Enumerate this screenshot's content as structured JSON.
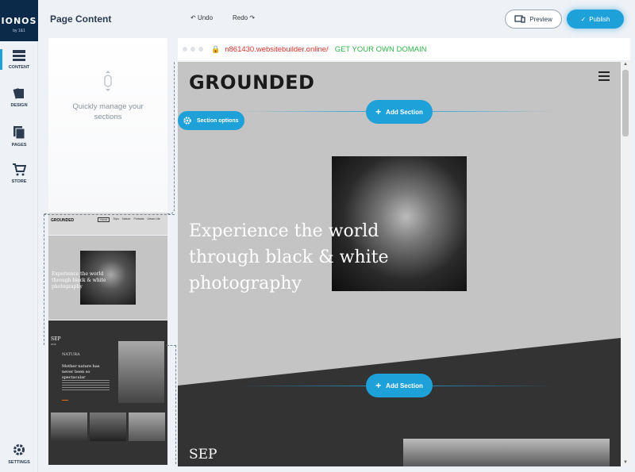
{
  "rail": {
    "brand": "IONOS",
    "brand_sub": "by 1&1",
    "items": [
      {
        "label": "CONTENT"
      },
      {
        "label": "DESIGN"
      },
      {
        "label": "PAGES"
      },
      {
        "label": "STORE"
      },
      {
        "label": "SETTINGS"
      }
    ]
  },
  "header": {
    "title": "Page Content",
    "undo": "Undo",
    "redo": "Redo",
    "preview": "Preview",
    "publish": "Publish"
  },
  "panel": {
    "hint_line1": "Quickly manage your",
    "hint_line2": "sections",
    "thumb1_brand": "GROUNDED",
    "thumb1_nav": [
      "Home",
      "Trips",
      "Nature",
      "Portraits",
      "Urban Life"
    ],
    "thumb2_text": "Experience the world through black & white photography",
    "thumb3_label": "SEP",
    "thumb3_sub": "2016",
    "thumb3_title": "NATURA",
    "thumb3_heading": "Mother nature has never been so spectacular"
  },
  "browser": {
    "url": "n861430.websitebuilder.online/",
    "domain_cta": "GET YOUR OWN DOMAIN"
  },
  "site": {
    "logo": "GROUNDED",
    "add_section": "Add Section",
    "section_options": "Section options",
    "hero_line1": "Experience the world",
    "hero_line2": "through black & white",
    "hero_line3": "photography",
    "sep": "SEP"
  },
  "colors": {
    "accent": "#1ea0d8",
    "url_red": "#d0342c",
    "domain_green": "#32b44a",
    "dark_section": "#333333",
    "hero_bg": "#c4c4c4"
  }
}
